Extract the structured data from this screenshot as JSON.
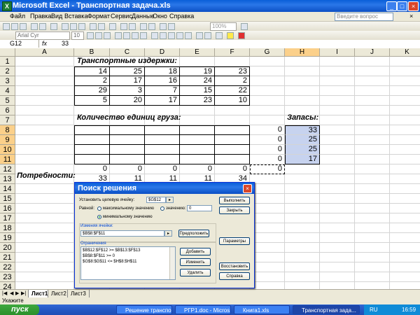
{
  "window": {
    "title": "Microsoft Excel - Транспортная задача.xls"
  },
  "menu": {
    "items": [
      "Файл",
      "Правка",
      "Вид",
      "Вставка",
      "Формат",
      "Сервис",
      "Данные",
      "Окно",
      "Справка"
    ],
    "ask_placeholder": "Введите вопрос",
    "close": "× "
  },
  "toolbar": {
    "font_name": "Arial Cyr",
    "font_size": "10",
    "zoom": "100%"
  },
  "formula_bar": {
    "name_box": "G12",
    "fx": "fx",
    "value": "33"
  },
  "columns": [
    "A",
    "B",
    "C",
    "D",
    "E",
    "F",
    "G",
    "H",
    "I",
    "J",
    "K"
  ],
  "selected_column": "H",
  "rows": [
    "1",
    "2",
    "3",
    "4",
    "5",
    "6",
    "7",
    "8",
    "9",
    "10",
    "11",
    "12",
    "13",
    "14",
    "15",
    "16",
    "17",
    "18",
    "19",
    "20",
    "21",
    "22",
    "23",
    "24"
  ],
  "selected_rows": [
    "8",
    "9",
    "10",
    "11"
  ],
  "sheet": {
    "costs_label": "Транспортные издержки:",
    "costs": [
      [
        "14",
        "25",
        "18",
        "19",
        "23"
      ],
      [
        "2",
        "17",
        "16",
        "24",
        "2"
      ],
      [
        "29",
        "3",
        "7",
        "15",
        "22"
      ],
      [
        "5",
        "20",
        "17",
        "23",
        "10"
      ]
    ],
    "quantity_label": "Количество единиц груза:",
    "supplies_label": "Запасы:",
    "g_col": [
      "0",
      "0",
      "0",
      "0"
    ],
    "supplies": [
      "33",
      "25",
      "25",
      "17"
    ],
    "row12": [
      "0",
      "0",
      "0",
      "0",
      "0"
    ],
    "g12": "0",
    "demand_label": "Потребности:",
    "demand": [
      "33",
      "11",
      "11",
      "11",
      "34"
    ]
  },
  "sheet_tabs": [
    "Лист1",
    "Лист2",
    "Лист3"
  ],
  "status": "Укажите",
  "taskbar": {
    "start": "пуск",
    "tasks": [
      "Решение транспо...",
      "РГР1.doc - Micros...",
      "Книга1.xls",
      "Транспортная зада..."
    ],
    "lang": "RU",
    "clock": "16:59"
  },
  "dialog": {
    "title": "Поиск решения",
    "target_label": "Установить целевую ячейку:",
    "target_value": "$G$12",
    "equal_label": "Равной:",
    "max_label": "максимальному значению",
    "value_label": "значению:",
    "value_input": "0",
    "min_label": "минимальному значению",
    "changing_label": "Изменяя ячейки:",
    "changing_value": "$B$8:$F$11",
    "constraints_label": "Ограничения",
    "constraints": [
      "$B$12:$F$12 >= $B$13:$F$13",
      "$B$8:$F$11 >= 0",
      "$G$8:$G$11 <= $H$8:$H$11"
    ],
    "buttons": {
      "guess": "Предположить",
      "solve": "Выполнить",
      "close": "Закрыть",
      "options": "Параметры",
      "add": "Добавить",
      "change": "Изменить",
      "delete": "Удалить",
      "reset": "Восстановить",
      "help": "Справка"
    }
  }
}
